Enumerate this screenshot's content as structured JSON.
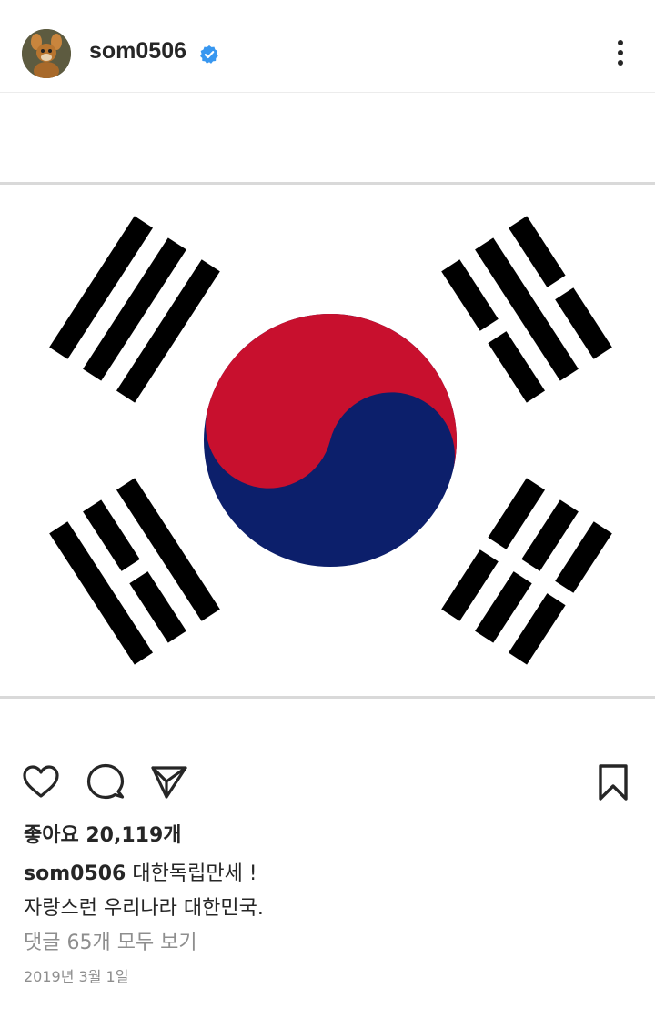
{
  "header": {
    "username": "som0506",
    "verified": true,
    "avatar_icon": "avatar-image",
    "more_icon": "more-options-icon"
  },
  "post": {
    "image_description_icon": "korean-flag-taegukgi",
    "colors": {
      "red": "#c8102e",
      "blue": "#0c1f6b",
      "black": "#000000",
      "verified_blue": "#3897f0"
    }
  },
  "actions": {
    "like_icon": "heart-icon",
    "comment_icon": "comment-icon",
    "share_icon": "send-icon",
    "save_icon": "bookmark-icon"
  },
  "likes": {
    "label": "좋아요 20,119개"
  },
  "caption": {
    "username": "som0506",
    "line1": "대한독립만세 !",
    "line2": "자랑스런 우리나라 대한민국."
  },
  "comments": {
    "label": "댓글 65개 모두 보기"
  },
  "date": "2019년 3월 1일"
}
